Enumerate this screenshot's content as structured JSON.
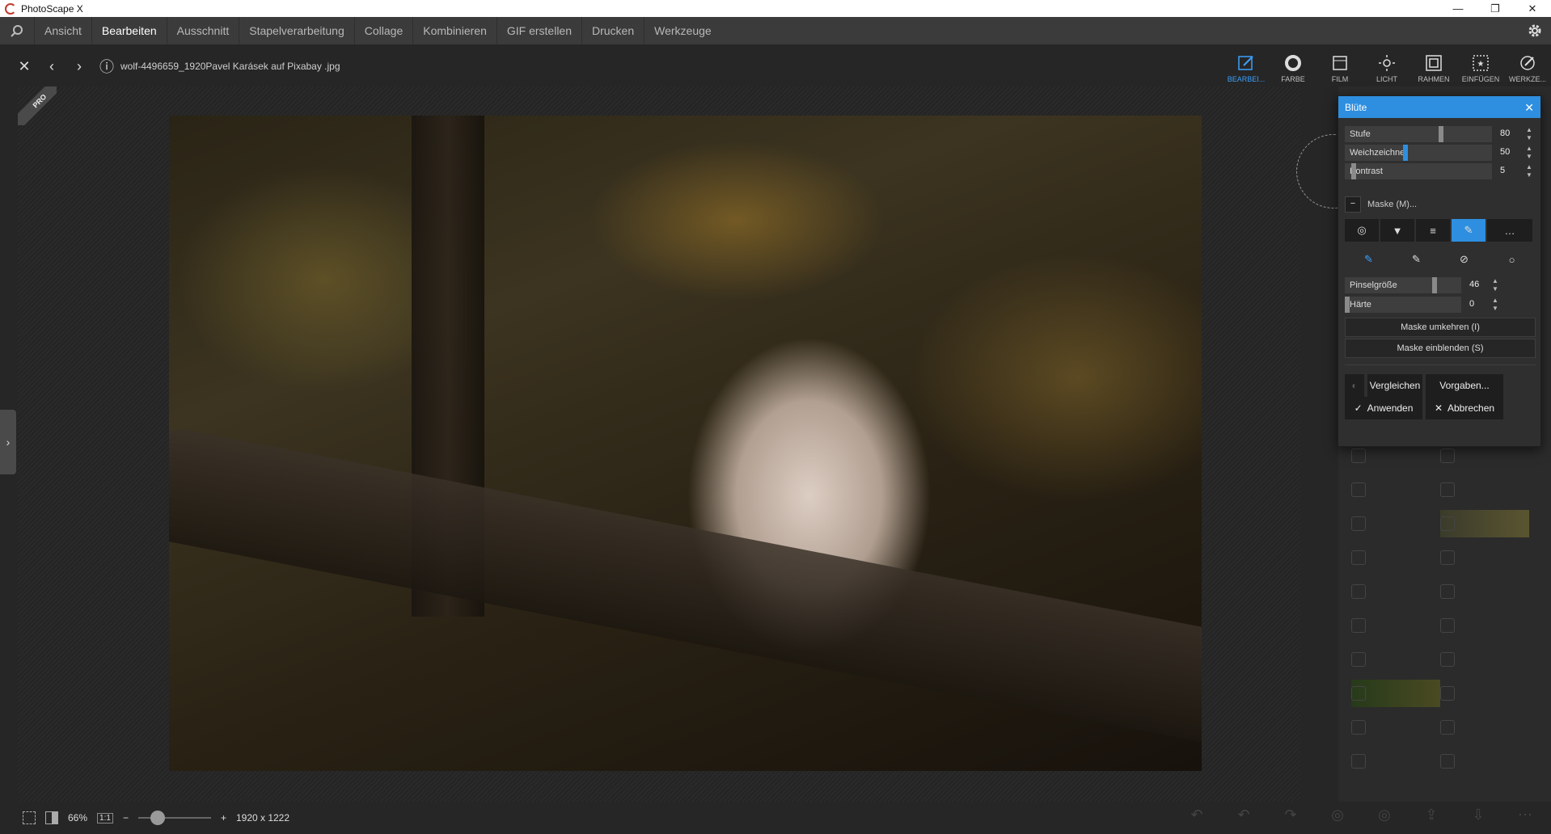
{
  "titlebar": {
    "title": "PhotoScape X",
    "minimize": "—",
    "restore": "❐",
    "close": "✕"
  },
  "menu": {
    "items": [
      "Ansicht",
      "Bearbeiten",
      "Ausschnitt",
      "Stapelverarbeitung",
      "Collage",
      "Kombinieren",
      "GIF erstellen",
      "Drucken",
      "Werkzeuge"
    ],
    "active": "Bearbeiten"
  },
  "toolbar": {
    "filename": "wolf-4496659_1920Pavel Karásek auf Pixabay .jpg",
    "tabs": [
      "BEARBEI...",
      "FARBE",
      "FILM",
      "LICHT",
      "RAHMEN",
      "EINFÜGEN",
      "WERKZE..."
    ],
    "active_tab": "BEARBEI..."
  },
  "badge": {
    "pro": "PRO"
  },
  "dialog": {
    "title": "Blüte",
    "sliders": [
      {
        "label": "Stufe",
        "value": "80",
        "level": 0.8
      },
      {
        "label": "Weichzeichner",
        "value": "50",
        "level": 0.5
      },
      {
        "label": "Kontrast",
        "value": "5",
        "level": 0.05
      }
    ],
    "mask_label": "Maske (M)...",
    "brush_sliders": [
      {
        "label": "Pinselgröße",
        "value": "46"
      },
      {
        "label": "Härte",
        "value": "0"
      }
    ],
    "invert_mask": "Maske umkehren (I)",
    "show_mask": "Maske einblenden (S)",
    "compare": "Vergleichen",
    "presets": "Vorgaben...",
    "apply": "Anwenden",
    "cancel": "Abbrechen"
  },
  "bottombar": {
    "zoom": "66%",
    "one_to_one": "1:1",
    "dimensions": "1920 x 1222",
    "minus": "−",
    "plus": "+"
  },
  "colors": {
    "accent": "#2e8fe0",
    "menubar": "#3b3b3b",
    "background": "#262626"
  }
}
